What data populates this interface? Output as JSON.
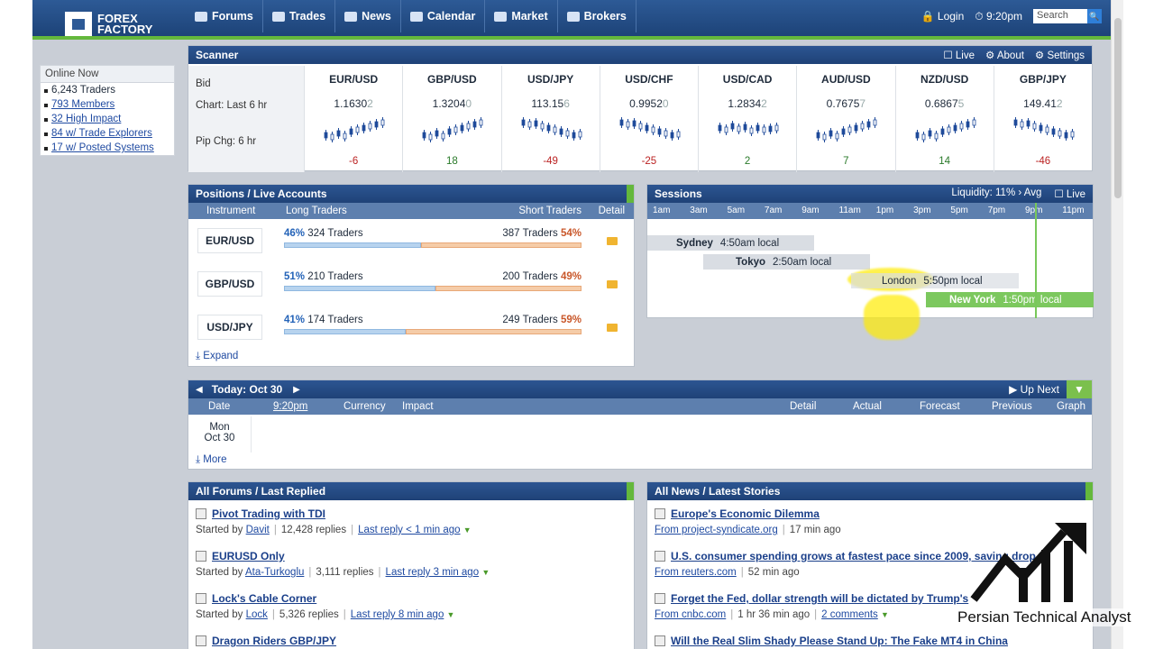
{
  "topbar": {
    "logo_line1": "FOREX",
    "logo_line2": "FACTORY",
    "nav": [
      "Forums",
      "Trades",
      "News",
      "Calendar",
      "Market",
      "Brokers"
    ],
    "login": "Login",
    "time": "9:20pm",
    "search_placeholder": "Search"
  },
  "online": {
    "title": "Online Now",
    "items": [
      "6,243 Traders",
      "793 Members",
      "32 High Impact",
      "84 w/ Trade Explorers",
      "17 w/ Posted Systems"
    ]
  },
  "scanner": {
    "title": "Scanner",
    "live": "Live",
    "about": "About",
    "settings": "Settings",
    "labels": {
      "bid": "Bid",
      "chart": "Chart: Last 6 hr",
      "pip": "Pip Chg: 6 hr"
    },
    "pairs": [
      {
        "name": "EUR/USD",
        "bid": "1.1630",
        "bid_dim": "2",
        "pip": "-6",
        "trend": "up"
      },
      {
        "name": "GBP/USD",
        "bid": "1.3204",
        "bid_dim": "0",
        "pip": "18",
        "trend": "up"
      },
      {
        "name": "USD/JPY",
        "bid": "113.15",
        "bid_dim": "6",
        "pip": "-49",
        "trend": "down"
      },
      {
        "name": "USD/CHF",
        "bid": "0.9952",
        "bid_dim": "0",
        "pip": "-25",
        "trend": "down"
      },
      {
        "name": "USD/CAD",
        "bid": "1.2834",
        "bid_dim": "2",
        "pip": "2",
        "trend": "flat"
      },
      {
        "name": "AUD/USD",
        "bid": "0.7675",
        "bid_dim": "7",
        "pip": "7",
        "trend": "up"
      },
      {
        "name": "NZD/USD",
        "bid": "0.6867",
        "bid_dim": "5",
        "pip": "14",
        "trend": "up"
      },
      {
        "name": "GBP/JPY",
        "bid": "149.41",
        "bid_dim": "2",
        "pip": "-46",
        "trend": "down"
      }
    ]
  },
  "positions": {
    "title": "Positions / Live Accounts",
    "headers": {
      "instrument": "Instrument",
      "long": "Long Traders",
      "short": "Short Traders",
      "detail": "Detail"
    },
    "rows": [
      {
        "instrument": "EUR/USD",
        "long_pct": "46%",
        "long_traders": "324 Traders",
        "short_traders": "387 Traders",
        "short_pct": "54%",
        "long_frac": 0.46
      },
      {
        "instrument": "GBP/USD",
        "long_pct": "51%",
        "long_traders": "210 Traders",
        "short_traders": "200 Traders",
        "short_pct": "49%",
        "long_frac": 0.51
      },
      {
        "instrument": "USD/JPY",
        "long_pct": "41%",
        "long_traders": "174 Traders",
        "short_traders": "249 Traders",
        "short_pct": "59%",
        "long_frac": 0.41
      }
    ],
    "expand": "Expand"
  },
  "sessions": {
    "title": "Sessions",
    "liquidity": "Liquidity: 11% › Avg",
    "live": "Live",
    "hours": [
      "1am",
      "3am",
      "5am",
      "7am",
      "9am",
      "11am",
      "1pm",
      "3pm",
      "5pm",
      "7pm",
      "9pm",
      "11pm"
    ],
    "items": [
      {
        "city": "Sydney",
        "local": "4:50am local"
      },
      {
        "city": "Tokyo",
        "local": "2:50am local"
      },
      {
        "city": "London",
        "local": "5:50pm local"
      },
      {
        "city": "New York",
        "local": "1:50pm local"
      }
    ],
    "annotation": "3"
  },
  "calendar": {
    "today": "Today: Oct 30",
    "up_next": "Up Next",
    "headers": {
      "date": "Date",
      "time": "9:20pm",
      "currency": "Currency",
      "impact": "Impact",
      "detail": "Detail",
      "actual": "Actual",
      "forecast": "Forecast",
      "previous": "Previous",
      "graph": "Graph"
    },
    "day": "Mon",
    "date": "Oct 30",
    "more": "More"
  },
  "forums": {
    "title": "All Forums / Last Replied",
    "items": [
      {
        "title": "Pivot Trading with TDI",
        "by": "Started by",
        "author": "Davit",
        "replies": "12,428 replies",
        "last": "Last reply < 1 min ago"
      },
      {
        "title": "EURUSD Only",
        "by": "Started by",
        "author": "Ata-Turkoglu",
        "replies": "3,111 replies",
        "last": "Last reply 3 min ago"
      },
      {
        "title": "Lock's Cable Corner",
        "by": "Started by",
        "author": "Lock",
        "replies": "5,326 replies",
        "last": "Last reply 8 min ago"
      },
      {
        "title": "Dragon Riders GBP/JPY",
        "by": "",
        "author": "",
        "replies": "",
        "last": ""
      }
    ]
  },
  "news": {
    "title": "All News / Latest Stories",
    "items": [
      {
        "title": "Europe's Economic Dilemma",
        "from": "From project-syndicate.org",
        "ago": "17 min ago",
        "comments": ""
      },
      {
        "title": "U.S. consumer spending grows at fastest pace since 2009, saving drop",
        "from": "From reuters.com",
        "ago": "52 min ago",
        "comments": ""
      },
      {
        "title": "Forget the Fed, dollar strength will be dictated by Trump's",
        "from": "From cnbc.com",
        "ago": "1 hr 36 min ago",
        "comments": "2 comments"
      },
      {
        "title": "Will the Real Slim Shady Please Stand Up: The Fake MT4 in China",
        "from": "",
        "ago": "",
        "comments": ""
      }
    ]
  },
  "watermark": {
    "text": "Persian Technical Analyst"
  }
}
